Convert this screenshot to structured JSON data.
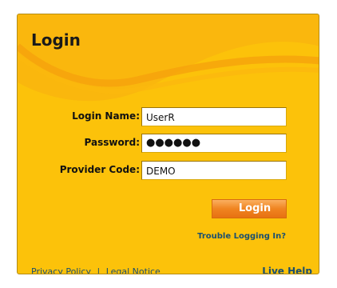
{
  "login_panel": {
    "title": "Login",
    "fields": [
      {
        "label": "Login Name:",
        "value": "UserR"
      },
      {
        "label": "Password:",
        "value": "●●●●●●"
      },
      {
        "label": "Provider Code:",
        "value": "DEMO"
      }
    ],
    "submit_label": "Login",
    "trouble_link": "Trouble Logging In?",
    "footer": {
      "privacy": "Privacy Policy",
      "separator": "|",
      "legal": "Legal Notice",
      "live_help": "Live Help"
    }
  },
  "colors": {
    "panel": "#fcc20a",
    "wave": "#f8a90c",
    "button": "#f08420",
    "link": "#1a4f70"
  }
}
